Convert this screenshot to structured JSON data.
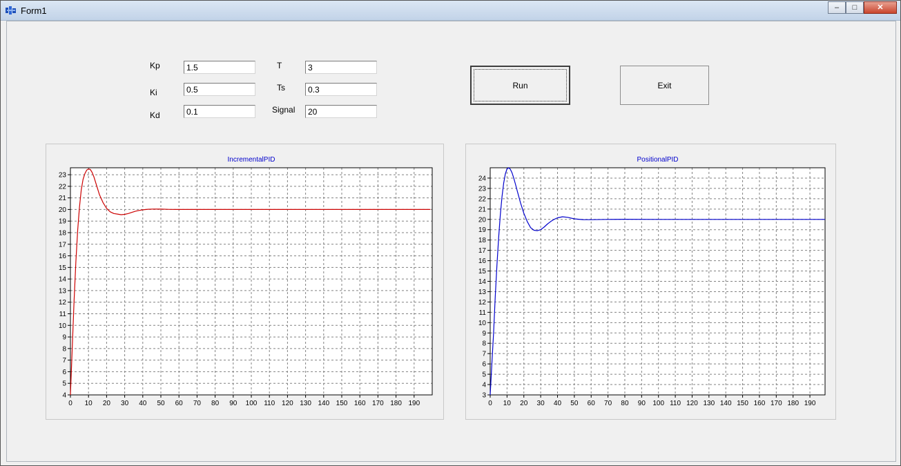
{
  "window": {
    "title": "Form1",
    "controls": {
      "minimize": "–",
      "maximize": "□",
      "close": "✕"
    }
  },
  "params": {
    "kp": {
      "label": "Kp",
      "value": "1.5"
    },
    "ki": {
      "label": "Ki",
      "value": "0.5"
    },
    "kd": {
      "label": "Kd",
      "value": "0.1"
    },
    "t": {
      "label": "T",
      "value": "3"
    },
    "ts": {
      "label": "Ts",
      "value": "0.3"
    },
    "signal": {
      "label": "Signal",
      "value": "20"
    }
  },
  "buttons": {
    "run": "Run",
    "exit": "Exit"
  },
  "chart_data": [
    {
      "type": "line",
      "title": "IncrementalPID",
      "color": "#cc0000",
      "xlim": [
        0,
        200
      ],
      "ylim": [
        4,
        23.6
      ],
      "xticks": [
        0,
        10,
        20,
        30,
        40,
        50,
        60,
        70,
        80,
        90,
        100,
        110,
        120,
        130,
        140,
        150,
        160,
        170,
        180,
        190
      ],
      "yticks": [
        4,
        5,
        6,
        7,
        8,
        9,
        10,
        11,
        12,
        13,
        14,
        15,
        16,
        17,
        18,
        19,
        20,
        21,
        22,
        23
      ],
      "grid": true,
      "series": [
        {
          "x": [
            0,
            1,
            2,
            3,
            4,
            5,
            6,
            7,
            8,
            9,
            10,
            11,
            12,
            13,
            14,
            15,
            16,
            18,
            20,
            22,
            24,
            26,
            28,
            30,
            32,
            34,
            36,
            38,
            40,
            43,
            46,
            50,
            55,
            60,
            80,
            100,
            150,
            199
          ],
          "y": [
            4,
            8,
            12,
            15.5,
            18.2,
            20.2,
            21.7,
            22.6,
            23.1,
            23.4,
            23.5,
            23.45,
            23.2,
            22.8,
            22.3,
            21.8,
            21.3,
            20.6,
            20.1,
            19.8,
            19.65,
            19.6,
            19.55,
            19.58,
            19.65,
            19.75,
            19.85,
            19.92,
            19.97,
            20.02,
            20.04,
            20.03,
            20.01,
            20,
            20,
            20,
            20,
            20
          ]
        }
      ]
    },
    {
      "type": "line",
      "title": "PositionalPID",
      "color": "#0000cc",
      "xlim": [
        0,
        199
      ],
      "ylim": [
        3,
        25
      ],
      "xticks": [
        0,
        10,
        20,
        30,
        40,
        50,
        60,
        70,
        80,
        90,
        100,
        110,
        120,
        130,
        140,
        150,
        160,
        170,
        180,
        190
      ],
      "yticks": [
        3,
        4,
        5,
        6,
        7,
        8,
        9,
        10,
        11,
        12,
        13,
        14,
        15,
        16,
        17,
        18,
        19,
        20,
        21,
        22,
        23,
        24
      ],
      "grid": true,
      "series": [
        {
          "x": [
            0,
            1,
            2,
            3,
            4,
            5,
            6,
            7,
            8,
            9,
            10,
            11,
            12,
            13,
            14,
            15,
            16,
            18,
            20,
            22,
            24,
            26,
            28,
            30,
            32,
            34,
            36,
            38,
            40,
            43,
            46,
            50,
            55,
            60,
            70,
            80,
            100,
            150,
            199
          ],
          "y": [
            3,
            6,
            9,
            12.5,
            15.5,
            18.2,
            20.4,
            22.2,
            23.5,
            24.4,
            24.9,
            25,
            24.85,
            24.5,
            24,
            23.4,
            22.8,
            21.6,
            20.6,
            19.8,
            19.2,
            18.95,
            18.9,
            19,
            19.25,
            19.55,
            19.8,
            20,
            20.15,
            20.25,
            20.2,
            20.05,
            19.98,
            19.97,
            20,
            20.01,
            20,
            20,
            20
          ]
        }
      ]
    }
  ]
}
